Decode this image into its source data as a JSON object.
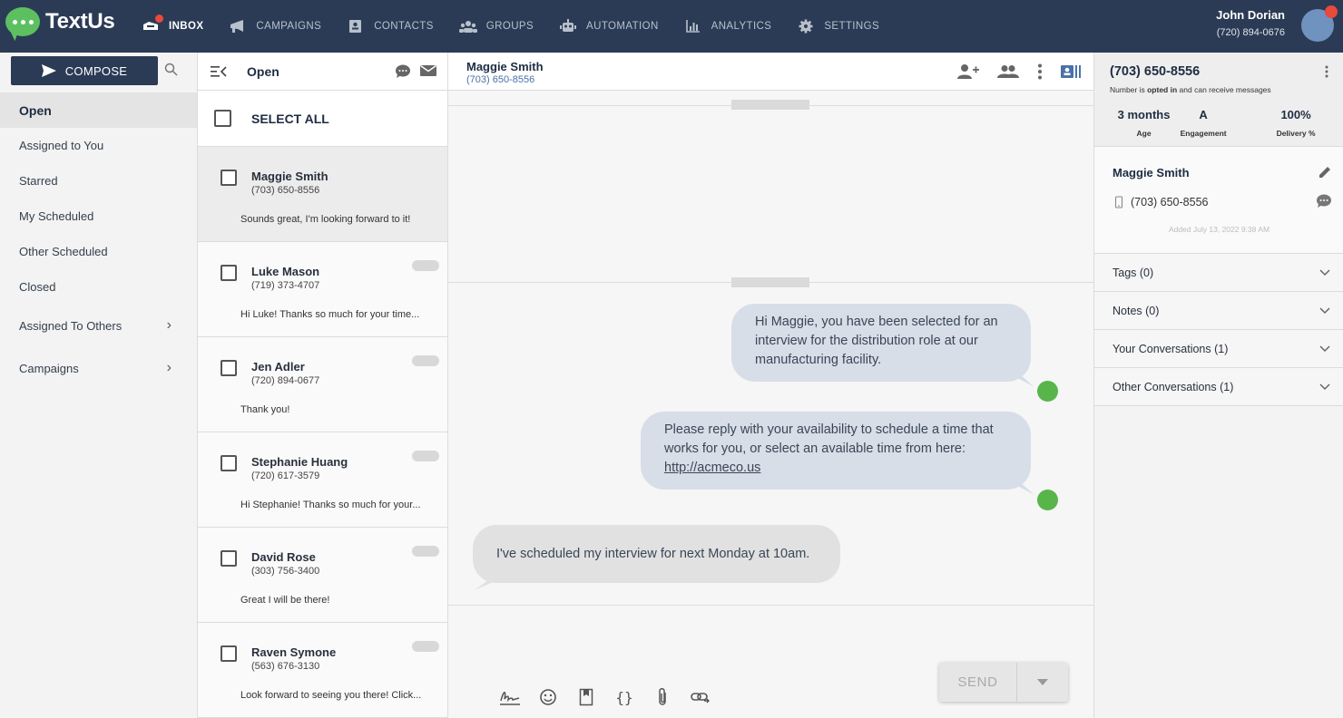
{
  "app": {
    "name": "TextUs"
  },
  "nav": {
    "items": [
      {
        "label": "INBOX",
        "icon": "inbox-icon",
        "active": true
      },
      {
        "label": "CAMPAIGNS",
        "icon": "megaphone-icon"
      },
      {
        "label": "CONTACTS",
        "icon": "contact-card-icon"
      },
      {
        "label": "GROUPS",
        "icon": "groups-icon"
      },
      {
        "label": "AUTOMATION",
        "icon": "robot-icon"
      },
      {
        "label": "ANALYTICS",
        "icon": "bar-chart-icon"
      },
      {
        "label": "SETTINGS",
        "icon": "gear-icon"
      }
    ]
  },
  "user": {
    "name": "John Dorian",
    "phone": "(720) 894-0676"
  },
  "sidebar": {
    "compose_label": "COMPOSE",
    "items": [
      {
        "label": "Open",
        "active": true
      },
      {
        "label": "Assigned to You"
      },
      {
        "label": "Starred"
      },
      {
        "label": "My Scheduled"
      },
      {
        "label": "Other Scheduled"
      },
      {
        "label": "Closed"
      },
      {
        "label": "Assigned To Others",
        "expandable": true
      },
      {
        "label": "Campaigns",
        "expandable": true
      }
    ]
  },
  "conversation_list": {
    "title": "Open",
    "select_all_label": "SELECT ALL",
    "items": [
      {
        "name": "Maggie Smith",
        "phone": "(703) 650-8556",
        "snippet": "Sounds great, I'm looking forward to it!",
        "selected": true
      },
      {
        "name": "Luke Mason",
        "phone": "(719) 373-4707",
        "snippet": "Hi Luke! Thanks so much for your time..."
      },
      {
        "name": "Jen Adler",
        "phone": "(720) 894-0677",
        "snippet": "Thank you!"
      },
      {
        "name": "Stephanie Huang",
        "phone": "(720) 617-3579",
        "snippet": "Hi Stephanie! Thanks so much for your..."
      },
      {
        "name": "David Rose",
        "phone": "(303) 756-3400",
        "snippet": "Great I will be there!"
      },
      {
        "name": "Raven Symone",
        "phone": "(563) 676-3130",
        "snippet": "Look forward to seeing you there! Click..."
      }
    ]
  },
  "conversation": {
    "contact_name": "Maggie Smith",
    "contact_phone": "(703) 650-8556",
    "messages": [
      {
        "direction": "outbound",
        "text": "Hi Maggie, you have been selected for an interview for the distribution role at our manufacturing facility."
      },
      {
        "direction": "outbound",
        "text": "Please reply with your availability to schedule a time that works for you, or select an available time from here:",
        "link": "http://acmeco.us"
      },
      {
        "direction": "inbound",
        "text": "I've scheduled my interview for next Monday at 10am."
      }
    ],
    "send_label": "SEND"
  },
  "details": {
    "phone": "(703) 650-8556",
    "optin_prefix": "Number is",
    "optin_status": "opted in",
    "optin_suffix": "and can receive messages",
    "stats": [
      {
        "value": "3 months",
        "label": "Age"
      },
      {
        "value": "A",
        "label": "Engagement"
      },
      {
        "value": "100%",
        "label": "Delivery %"
      }
    ],
    "contact_name": "Maggie Smith",
    "contact_phone": "(703) 650-8556",
    "added": "Added July 13, 2022 9:38 AM",
    "sections": [
      "Tags (0)",
      "Notes (0)",
      "Your Conversations (1)",
      "Other Conversations (1)"
    ]
  },
  "colors": {
    "navbar": "#2b3b55",
    "accent_green": "#58b54a",
    "outbound_bubble": "#d8dee8",
    "inbound_bubble": "#e1e1e1"
  }
}
